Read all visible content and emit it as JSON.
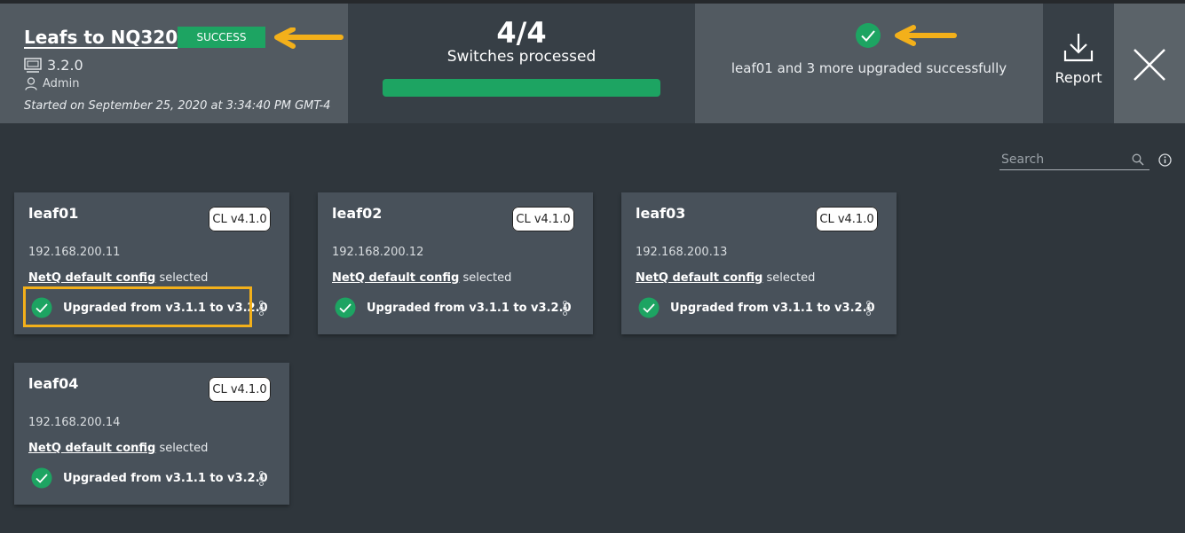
{
  "header": {
    "job_title": "Leafs to NQ320",
    "status": "SUCCESS",
    "version": "3.2.0",
    "user": "Admin",
    "started": "Started on September 25, 2020 at 3:34:40 PM GMT-4"
  },
  "progress": {
    "count": "4/4",
    "label": "Switches processed",
    "fraction": 1.0
  },
  "result": {
    "summary": "leaf01 and 3 more upgraded successfully"
  },
  "report": {
    "label": "Report"
  },
  "search": {
    "placeholder": "Search",
    "value": ""
  },
  "cards": [
    {
      "name": "leaf01",
      "os": "CL v4.1.0",
      "ip": "192.168.200.11",
      "config_link": "NetQ default config",
      "config_suffix": " selected",
      "status": "Upgraded from v3.1.1 to v3.2.0"
    },
    {
      "name": "leaf02",
      "os": "CL v4.1.0",
      "ip": "192.168.200.12",
      "config_link": "NetQ default config",
      "config_suffix": " selected",
      "status": "Upgraded from v3.1.1 to v3.2.0"
    },
    {
      "name": "leaf03",
      "os": "CL v4.1.0",
      "ip": "192.168.200.13",
      "config_link": "NetQ default config",
      "config_suffix": " selected",
      "status": "Upgraded from v3.1.1 to v3.2.0"
    },
    {
      "name": "leaf04",
      "os": "CL v4.1.0",
      "ip": "192.168.200.14",
      "config_link": "NetQ default config",
      "config_suffix": " selected",
      "status": "Upgraded from v3.1.1 to v3.2.0"
    }
  ],
  "colors": {
    "success": "#1da462",
    "annotation": "#f3b01a",
    "background": "#2f363c",
    "card": "#48515a"
  },
  "icons": {
    "version": "netq-device-icon",
    "user": "user-icon",
    "result": "check-circle-icon",
    "report": "download-icon",
    "close": "close-icon",
    "search": "search-icon",
    "info": "info-icon",
    "menu": "kebab-menu-icon"
  }
}
